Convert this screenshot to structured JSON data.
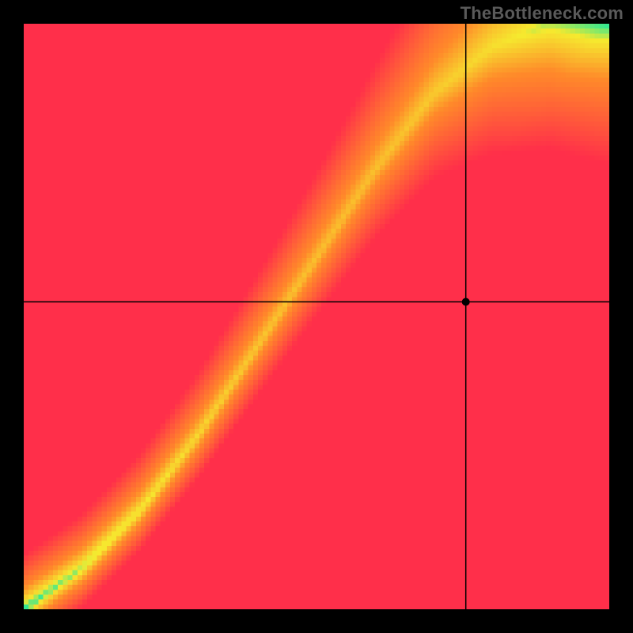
{
  "attribution": "TheBottleneck.com",
  "chart_data": {
    "type": "heatmap",
    "title": "",
    "xlabel": "",
    "ylabel": "",
    "xlim": [
      0,
      1
    ],
    "ylim": [
      0,
      1
    ],
    "grid_size": 120,
    "crosshair": {
      "x": 0.755,
      "y": 0.525
    },
    "marker": {
      "x": 0.755,
      "y": 0.525,
      "radius_px": 5
    },
    "optimal_ridge": {
      "description": "green ridge y≈f(x); below curve = bottleneck one side, above = other",
      "points": [
        [
          0.0,
          0.0
        ],
        [
          0.1,
          0.07
        ],
        [
          0.2,
          0.17
        ],
        [
          0.3,
          0.3
        ],
        [
          0.4,
          0.45
        ],
        [
          0.5,
          0.6
        ],
        [
          0.6,
          0.75
        ],
        [
          0.7,
          0.88
        ],
        [
          0.8,
          0.96
        ],
        [
          0.9,
          1.0
        ],
        [
          1.0,
          1.0
        ]
      ]
    },
    "color_stops": {
      "green": "#17e8a0",
      "yellow": "#f6ea2f",
      "orange": "#ff8a2a",
      "red": "#ff2f4a"
    }
  }
}
